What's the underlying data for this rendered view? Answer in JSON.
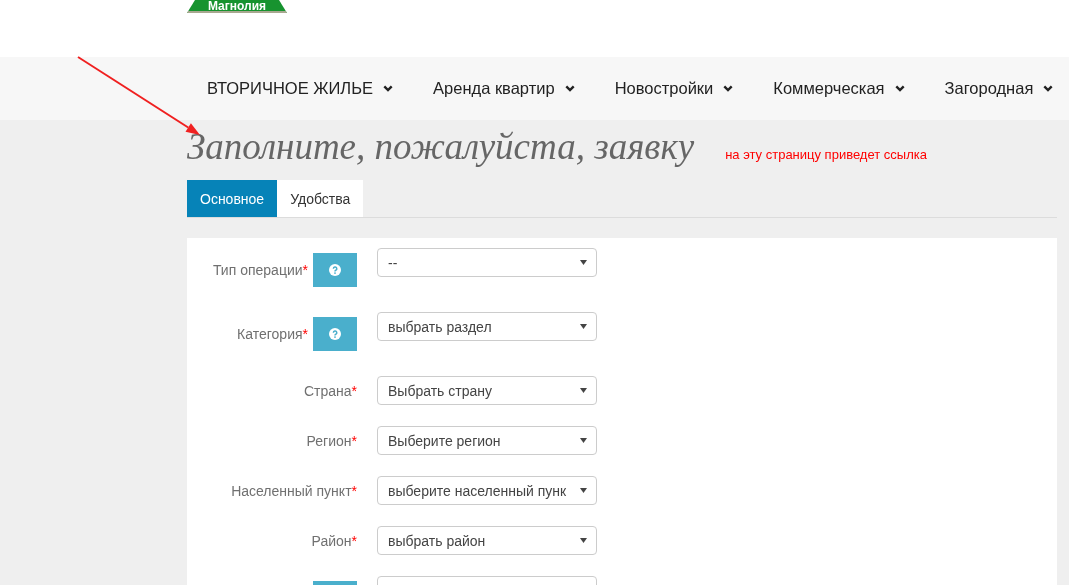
{
  "logo": {
    "text": "Магнолия"
  },
  "nav": [
    {
      "label": "ВТОРИЧНОЕ ЖИЛЬЕ"
    },
    {
      "label": "Аренда квартир"
    },
    {
      "label": "Новостройки"
    },
    {
      "label": "Коммерческая"
    },
    {
      "label": "Загородная"
    }
  ],
  "page": {
    "title": "Заполните, пожалуйста, заявку",
    "note": "на эту страницу приведет ссылка"
  },
  "tabs": [
    {
      "label": "Основное",
      "selected": true
    },
    {
      "label": "Удобства",
      "selected": false
    }
  ],
  "form": {
    "fields": [
      {
        "label": "Тип операции",
        "required_mark": "*",
        "help": true,
        "value": "--"
      },
      {
        "label": "Категория",
        "required_mark": "*",
        "help": true,
        "value": "выбрать раздел"
      },
      {
        "label": "Страна",
        "required_mark": "*",
        "help": false,
        "value": "Выбрать страну"
      },
      {
        "label": "Регион",
        "required_mark": "*",
        "help": false,
        "value": "Выберите регион"
      },
      {
        "label": "Населенный пункт",
        "required_mark": "*",
        "help": false,
        "value": "выберите населенный пунк"
      },
      {
        "label": "Район",
        "required_mark": "*",
        "help": false,
        "value": "выбрать район"
      },
      {
        "help": true
      }
    ]
  }
}
